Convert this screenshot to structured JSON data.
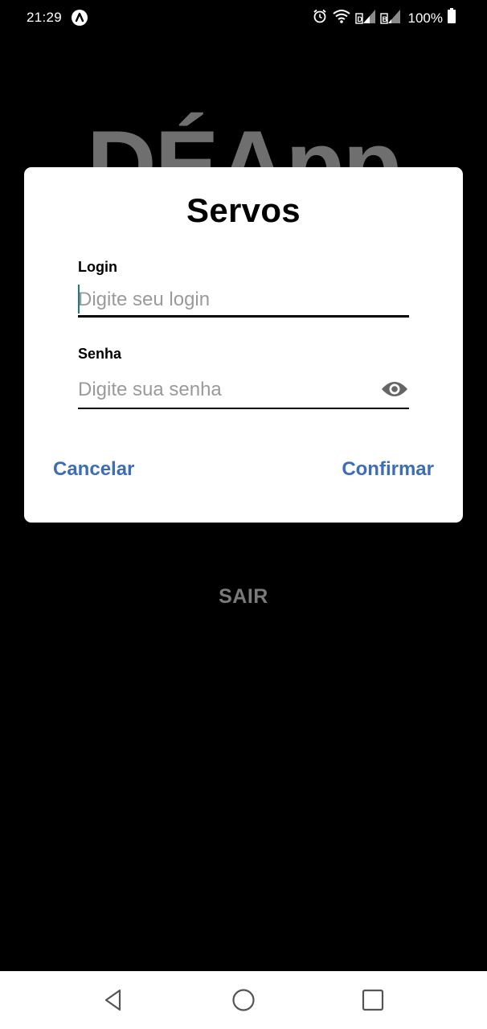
{
  "status_bar": {
    "time": "21:29",
    "battery": "100%",
    "icons": [
      "app-notification-icon",
      "alarm-icon",
      "wifi-icon",
      "signal-icon",
      "signal-icon",
      "battery-icon"
    ]
  },
  "background": {
    "app_title": "DÉApp",
    "exit_label": "SAIR"
  },
  "dialog": {
    "title": "Servos",
    "login": {
      "label": "Login",
      "placeholder": "Digite seu login",
      "value": ""
    },
    "password": {
      "label": "Senha",
      "placeholder": "Digite sua senha",
      "value": "",
      "toggle_icon": "eye-icon"
    },
    "cancel_label": "Cancelar",
    "confirm_label": "Confirmar",
    "accent_color": "#3d6db5"
  },
  "nav_bar": {
    "buttons": [
      "back-icon",
      "home-icon",
      "recents-icon"
    ]
  }
}
